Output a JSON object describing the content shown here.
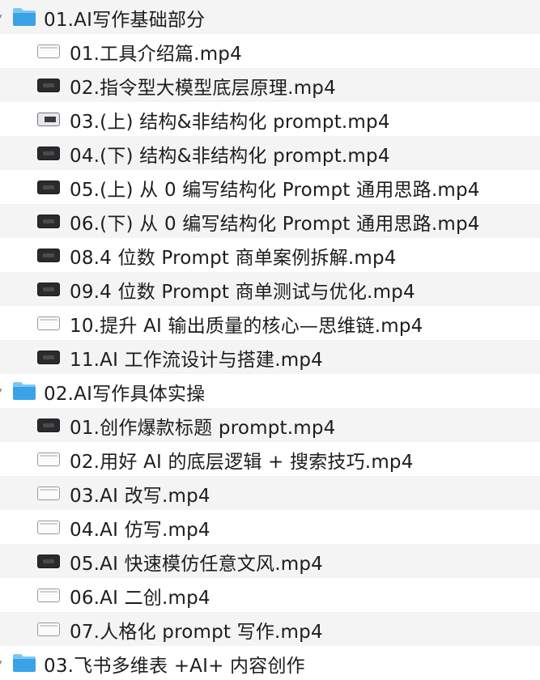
{
  "folders": [
    {
      "label": "01.AI写作基础部分",
      "files": [
        {
          "label": "01.工具介绍篇.mp4",
          "icon": "light"
        },
        {
          "label": "02.指令型大模型底层原理.mp4",
          "icon": "dark"
        },
        {
          "label": "03.(上) 结构&非结构化 prompt.mp4",
          "icon": "mixed"
        },
        {
          "label": "04.(下) 结构&非结构化 prompt.mp4",
          "icon": "dark"
        },
        {
          "label": "05.(上) 从 0 编写结构化 Prompt 通用思路.mp4",
          "icon": "dark"
        },
        {
          "label": "06.(下) 从 0 编写结构化 Prompt 通用思路.mp4",
          "icon": "dark"
        },
        {
          "label": "08.4 位数 Prompt 商单案例拆解.mp4",
          "icon": "dark"
        },
        {
          "label": "09.4 位数 Prompt 商单测试与优化.mp4",
          "icon": "dark"
        },
        {
          "label": "10.提升 AI 输出质量的核心—思维链.mp4",
          "icon": "light"
        },
        {
          "label": "11.AI 工作流设计与搭建.mp4",
          "icon": "dark"
        }
      ]
    },
    {
      "label": "02.AI写作具体实操",
      "files": [
        {
          "label": "01.创作爆款标题 prompt.mp4",
          "icon": "dark"
        },
        {
          "label": "02.用好 AI 的底层逻辑 + 搜索技巧.mp4",
          "icon": "light"
        },
        {
          "label": "03.AI 改写.mp4",
          "icon": "light"
        },
        {
          "label": "04.AI 仿写.mp4",
          "icon": "light"
        },
        {
          "label": "05.AI 快速模仿任意文风.mp4",
          "icon": "dark"
        },
        {
          "label": "06.AI 二创.mp4",
          "icon": "light"
        },
        {
          "label": "07.人格化 prompt 写作.mp4",
          "icon": "light"
        }
      ]
    },
    {
      "label": "03.飞书多维表 +AI+ 内容创作",
      "files": []
    }
  ],
  "colors": {
    "stripe": "#f4f4f5",
    "folder_top": "#7cc6f2",
    "folder_body": "#3aa2e6",
    "text": "#1d1d1f"
  }
}
